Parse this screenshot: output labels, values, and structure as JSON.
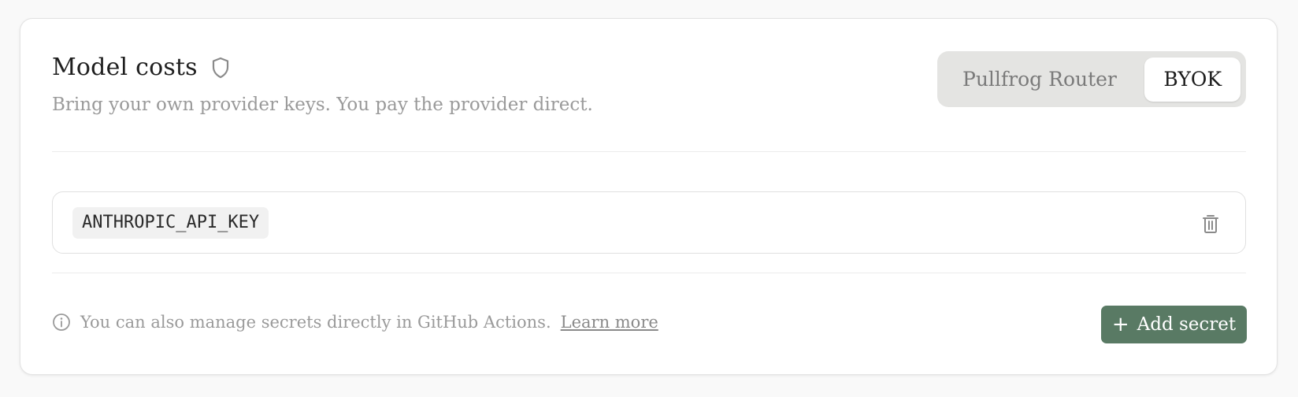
{
  "header": {
    "title": "Model costs",
    "subtitle": "Bring your own provider keys. You pay the provider direct.",
    "title_icon": "shield-icon"
  },
  "billing_toggle": {
    "options": [
      "Pullfrog Router",
      "BYOK"
    ],
    "selected": "BYOK"
  },
  "secrets": {
    "items": [
      {
        "name": "ANTHROPIC_API_KEY",
        "action_icon": "trash-icon"
      }
    ]
  },
  "footer": {
    "note": "You can also manage secrets directly in GitHub Actions.",
    "link_label": "Learn more",
    "info_icon": "info-icon",
    "add_button_label": "Add secret",
    "add_button_icon": "plus-icon"
  },
  "colors": {
    "primary_button": "#597a64",
    "toggle_bg": "#e4e4e2",
    "muted_text": "#9a9a9a"
  }
}
